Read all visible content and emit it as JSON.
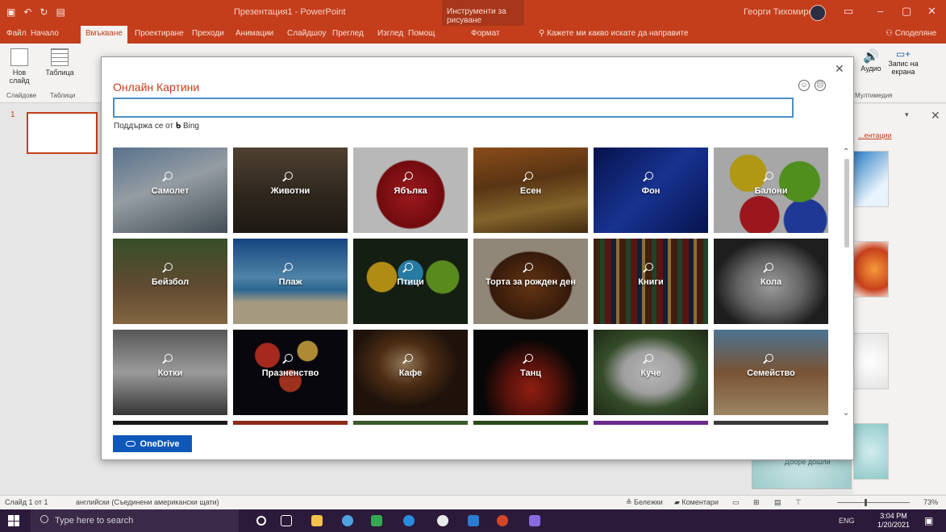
{
  "titlebar": {
    "doc_title": "Презентация1 - PowerPoint",
    "context_tab": "Инструменти за рисуване",
    "user_name": "Георги Тихомиров",
    "colors": {
      "accent": "#c43e1c",
      "dialog_title": "#c43e1c",
      "button": "#0f58b8"
    }
  },
  "ribbon_tabs": [
    "Файл",
    "Начало",
    "Вмъкване",
    "Проектиране",
    "Преходи",
    "Анимации",
    "Слайдшоу",
    "Преглед",
    "Изглед",
    "Помощ",
    "Формат"
  ],
  "tell_me": "Кажете ми какво искате да направите",
  "share": "Споделяне",
  "ribbon": {
    "new_slide": "Нов слайд",
    "table": "Таблица",
    "group_slides": "Слайдове",
    "group_tables": "Таблици",
    "audio": "Аудио",
    "screen_recording": "Запис на екрана",
    "group_multimedia": "Мултимедия"
  },
  "slide_panel": {
    "slide_number": "1"
  },
  "design_pane": {
    "link_text": "...ентации"
  },
  "bottom_preview_label": "Добре дошли",
  "dialog": {
    "title": "Онлайн Картини",
    "search_placeholder": "",
    "powered_by": "Поддържа се от",
    "bing": "Bing",
    "onedrive_label": "OneDrive",
    "tiles": [
      {
        "label": "Самолет",
        "icon": "search-icon"
      },
      {
        "label": "Животни",
        "icon": "search-icon"
      },
      {
        "label": "Ябълка",
        "icon": "search-icon"
      },
      {
        "label": "Есен",
        "icon": "search-icon"
      },
      {
        "label": "Фон",
        "icon": "search-icon"
      },
      {
        "label": "Балони",
        "icon": "search-icon"
      },
      {
        "label": "Бейзбол",
        "icon": "search-icon"
      },
      {
        "label": "Плаж",
        "icon": "search-icon"
      },
      {
        "label": "Птици",
        "icon": "search-icon"
      },
      {
        "label": "Торта за рожден ден",
        "icon": "search-icon"
      },
      {
        "label": "Книги",
        "icon": "search-icon"
      },
      {
        "label": "Кола",
        "icon": "search-icon"
      },
      {
        "label": "Котки",
        "icon": "search-icon"
      },
      {
        "label": "Празненство",
        "icon": "search-icon"
      },
      {
        "label": "Кафе",
        "icon": "search-icon"
      },
      {
        "label": "Танц",
        "icon": "search-icon"
      },
      {
        "label": "Куче",
        "icon": "search-icon"
      },
      {
        "label": "Семейство",
        "icon": "search-icon"
      }
    ]
  },
  "statusbar": {
    "slide_info": "Слайд 1 от 1",
    "language": "английски (Съединени американски щати)",
    "notes": "Бележки",
    "comments": "Коментари",
    "zoom": "73%"
  },
  "taskbar": {
    "search_placeholder": "Type here to search",
    "tray_lang": "ENG",
    "time": "3:04 PM",
    "date": "1/20/2021"
  }
}
